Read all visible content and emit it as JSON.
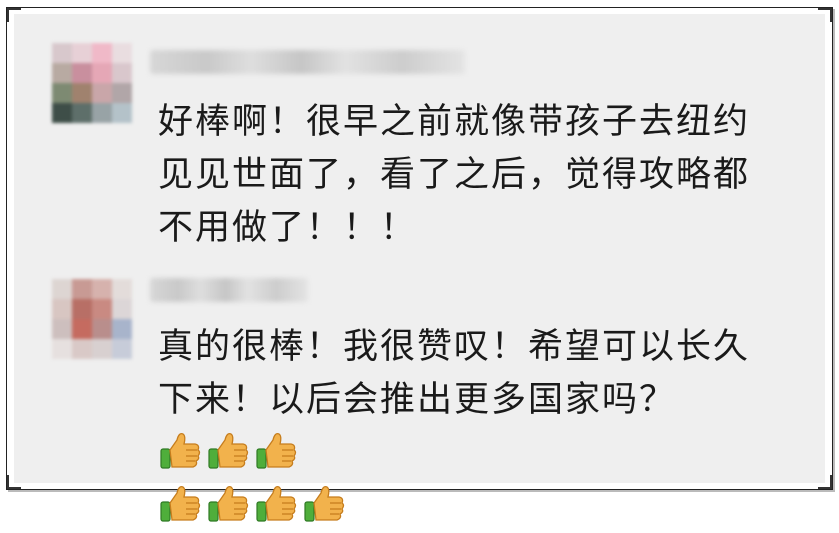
{
  "comments": [
    {
      "text": "好棒啊！很早之前就像带孩子去纽约见见世面了，看了之后，觉得攻略都不用做了！！！",
      "emoji": []
    },
    {
      "text": "真的很棒！我很赞叹！希望可以长久下来！以后会推出更多国家吗？",
      "emoji": [
        "thumbs-up-icon",
        "thumbs-up-icon",
        "thumbs-up-icon",
        "thumbs-up-icon",
        "thumbs-up-icon",
        "thumbs-up-icon",
        "thumbs-up-icon"
      ]
    }
  ],
  "colors": {
    "background": "#efefef",
    "text": "#1a1a1a",
    "thumb": "#f2b24c",
    "cuff": "#4fae3b"
  }
}
